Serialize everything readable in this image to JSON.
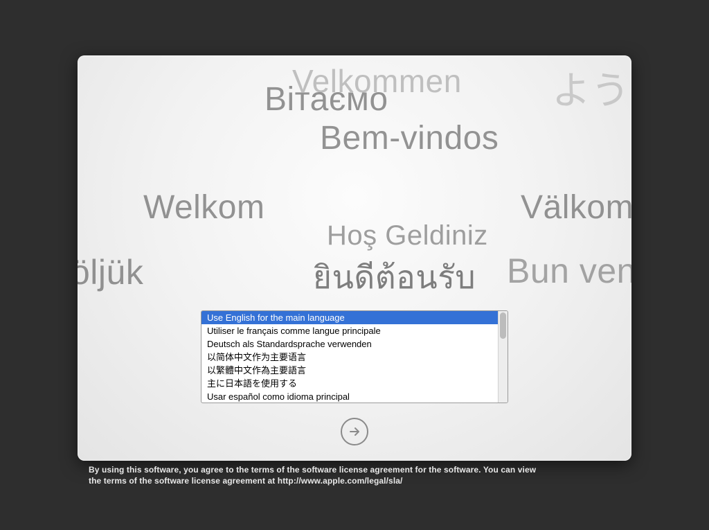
{
  "welcome_words": {
    "w1": "Velkommen",
    "w2": "Вітаємо",
    "w3": "Bem-vindos",
    "w4": "ようこ",
    "w5": "Welkom",
    "w6": "Hoş Geldiniz",
    "w7": "Välkomm",
    "w8": "öljük",
    "w9": "ยินดีต้อนรับ",
    "w10": "Bun ven"
  },
  "languages": [
    {
      "label": "Use English for the main language",
      "selected": true
    },
    {
      "label": "Utiliser le français comme langue principale",
      "selected": false
    },
    {
      "label": "Deutsch als Standardsprache verwenden",
      "selected": false
    },
    {
      "label": "以简体中文作为主要语言",
      "selected": false
    },
    {
      "label": "以繁體中文作為主要語言",
      "selected": false
    },
    {
      "label": "主に日本語を使用する",
      "selected": false
    },
    {
      "label": "Usar español como idioma principal",
      "selected": false
    }
  ],
  "legal": {
    "line1": "By using this software, you agree to the terms of the software license agreement for the software. You can view",
    "line2": "the terms of the software license agreement at http://www.apple.com/legal/sla/"
  }
}
